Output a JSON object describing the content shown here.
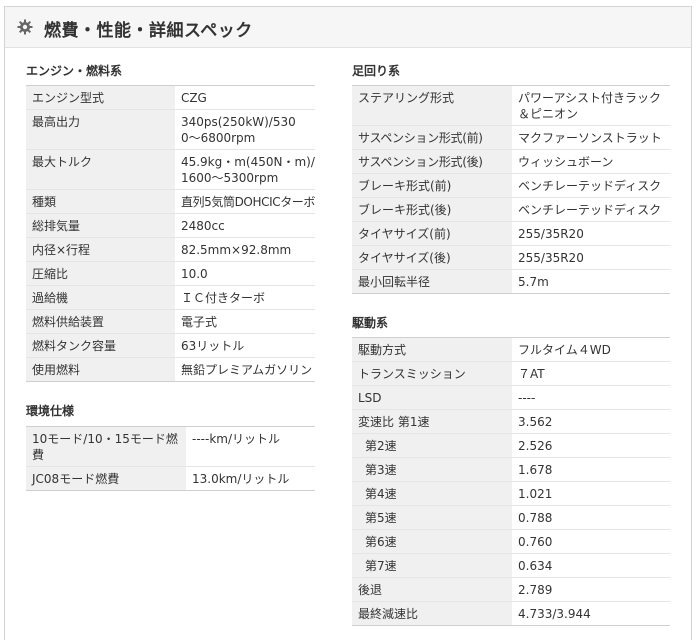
{
  "header": {
    "title": "燃費・性能・詳細スペック"
  },
  "engine": {
    "title": "エンジン・燃料系",
    "rows": [
      {
        "k": "エンジン型式",
        "v": "CZG"
      },
      {
        "k": "最高出力",
        "v": "340ps(250kW)/5300〜6800rpm"
      },
      {
        "k": "最大トルク",
        "v": "45.9kg・m(450N・m)/1600〜5300rpm"
      },
      {
        "k": "種類",
        "v": "直列5気筒DOHCICターボ"
      },
      {
        "k": "総排気量",
        "v": "2480cc"
      },
      {
        "k": "内径×行程",
        "v": "82.5mm×92.8mm"
      },
      {
        "k": "圧縮比",
        "v": "10.0"
      },
      {
        "k": "過給機",
        "v": "ＩＣ付きターボ"
      },
      {
        "k": "燃料供給装置",
        "v": "電子式"
      },
      {
        "k": "燃料タンク容量",
        "v": "63リットル"
      },
      {
        "k": "使用燃料",
        "v": "無鉛プレミアムガソリン"
      }
    ]
  },
  "env": {
    "title": "環境仕様",
    "rows": [
      {
        "k": "10モード/10・15モード燃費",
        "v": "----km/リットル"
      },
      {
        "k": "JC08モード燃費",
        "v": "13.0km/リットル"
      }
    ]
  },
  "suspension": {
    "title": "足回り系",
    "rows": [
      {
        "k": "ステアリング形式",
        "v": "パワーアシスト付きラック＆ピニオン"
      },
      {
        "k": "サスペンション形式(前)",
        "v": "マクファーソンストラット"
      },
      {
        "k": "サスペンション形式(後)",
        "v": "ウィッシュボーン"
      },
      {
        "k": "ブレーキ形式(前)",
        "v": "ベンチレーテッドディスク"
      },
      {
        "k": "ブレーキ形式(後)",
        "v": "ベンチレーテッドディスク"
      },
      {
        "k": "タイヤサイズ(前)",
        "v": "255/35R20"
      },
      {
        "k": "タイヤサイズ(後)",
        "v": "255/35R20"
      },
      {
        "k": "最小回転半径",
        "v": "5.7m"
      }
    ]
  },
  "drive": {
    "title": "駆動系",
    "rows": [
      {
        "k": "駆動方式",
        "v": "フルタイム４WD"
      },
      {
        "k": "トランスミッション",
        "v": "７AT"
      },
      {
        "k": "LSD",
        "v": "----"
      },
      {
        "k": "変速比 第1速",
        "v": "3.562"
      },
      {
        "k": "第2速",
        "v": "2.526"
      },
      {
        "k": "第3速",
        "v": "1.678"
      },
      {
        "k": "第4速",
        "v": "1.021"
      },
      {
        "k": "第5速",
        "v": "0.788"
      },
      {
        "k": "第6速",
        "v": "0.760"
      },
      {
        "k": "第7速",
        "v": "0.634"
      },
      {
        "k": "後退",
        "v": "2.789"
      },
      {
        "k": "最終減速比",
        "v": "4.733/3.944"
      }
    ]
  }
}
